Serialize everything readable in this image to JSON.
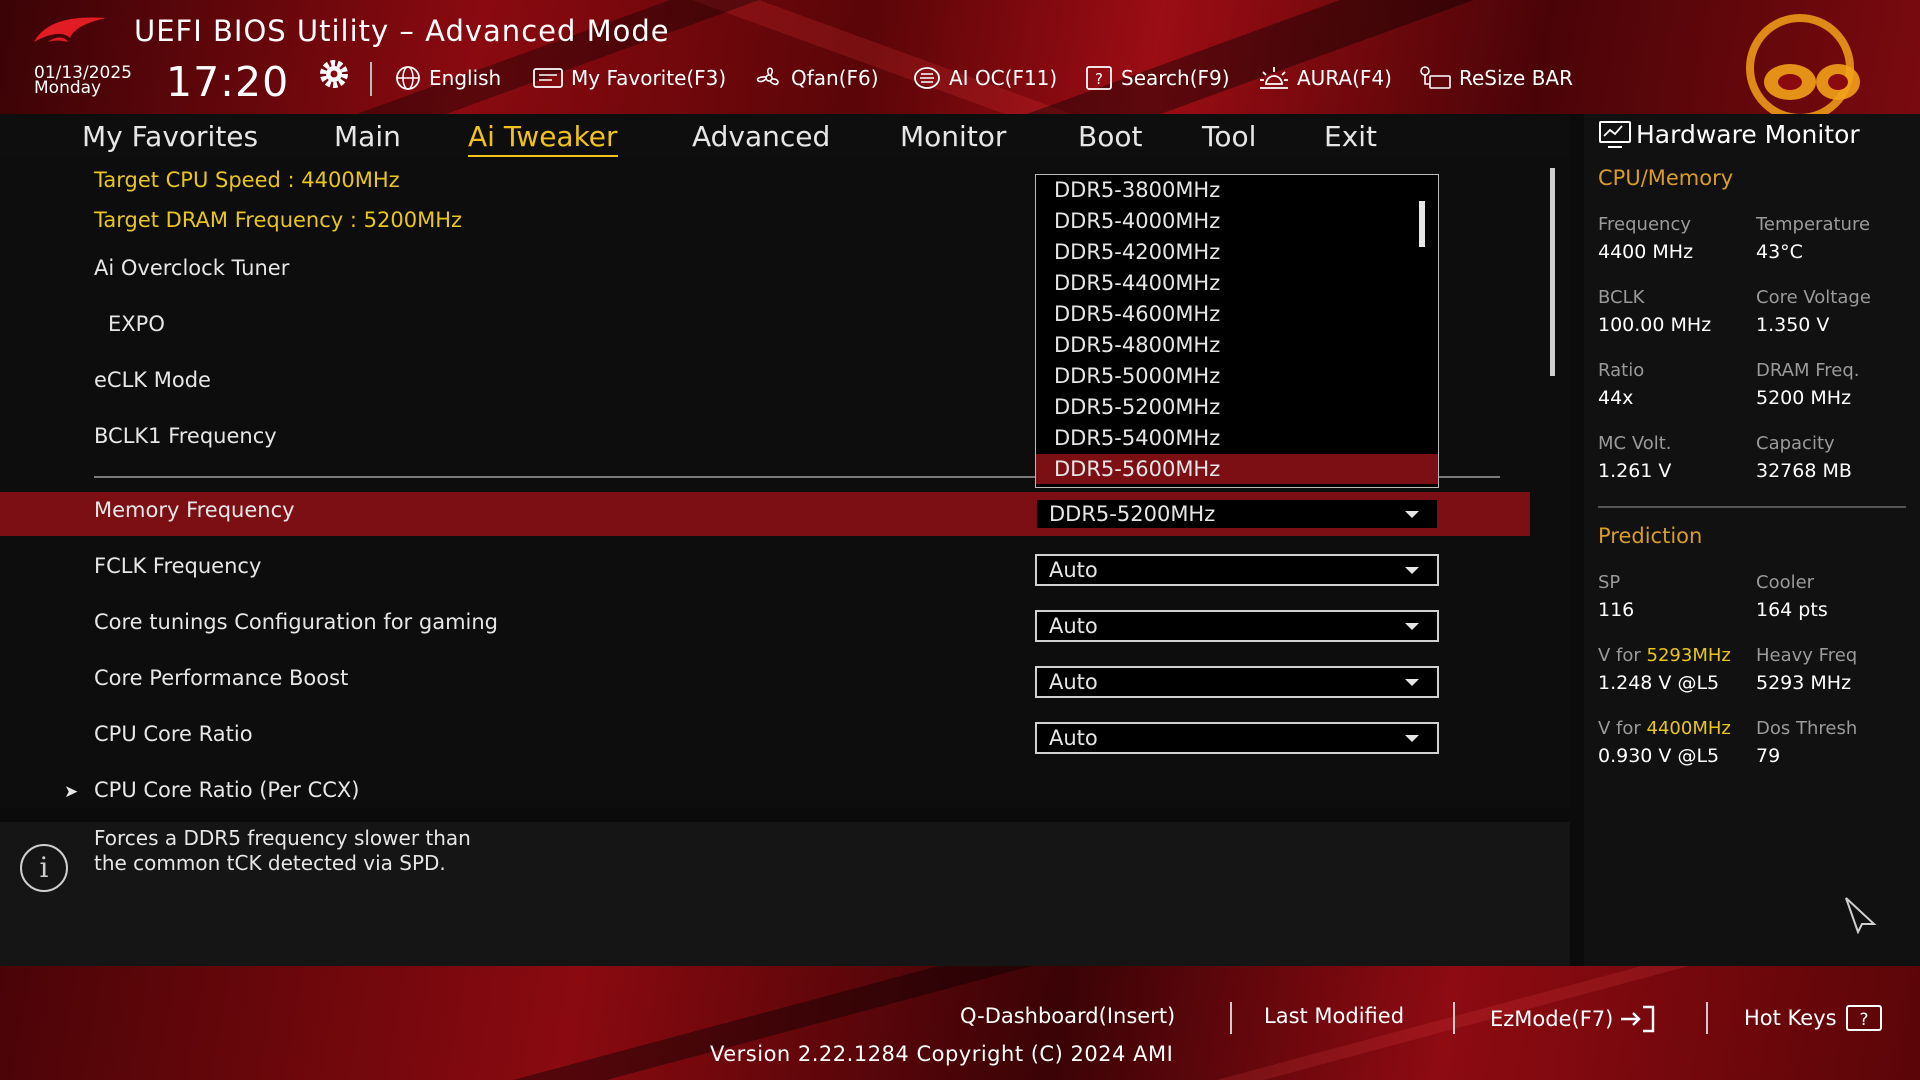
{
  "header": {
    "title": "UEFI BIOS Utility – Advanced Mode",
    "date": "01/13/2025",
    "day": "Monday",
    "time": "17:20",
    "toolbar": [
      {
        "label": "English",
        "icon": "globe-icon"
      },
      {
        "label": "My Favorite(F3)",
        "icon": "favorite-icon"
      },
      {
        "label": "Qfan(F6)",
        "icon": "fan-icon"
      },
      {
        "label": "AI OC(F11)",
        "icon": "ai-oc-icon"
      },
      {
        "label": "Search(F9)",
        "icon": "search-icon"
      },
      {
        "label": "AURA(F4)",
        "icon": "aura-icon"
      },
      {
        "label": "ReSize BAR",
        "icon": "resize-bar-icon"
      }
    ]
  },
  "nav": {
    "tabs": [
      "My Favorites",
      "Main",
      "Ai Tweaker",
      "Advanced",
      "Monitor",
      "Boot",
      "Tool",
      "Exit"
    ],
    "active": "Ai Tweaker"
  },
  "main": {
    "target_cpu": "Target CPU Speed : 4400MHz",
    "target_dram": "Target DRAM Frequency : 5200MHz",
    "settings": [
      {
        "label": "Ai Overclock Tuner"
      },
      {
        "label": "EXPO"
      },
      {
        "label": "eCLK Mode"
      },
      {
        "label": "BCLK1 Frequency"
      },
      {
        "label": "Memory Frequency",
        "value": "DDR5-5200MHz"
      },
      {
        "label": "FCLK Frequency",
        "value": "Auto"
      },
      {
        "label": "Core tunings Configuration for gaming",
        "value": "Auto"
      },
      {
        "label": "Core Performance Boost",
        "value": "Auto"
      },
      {
        "label": "CPU Core Ratio",
        "value": "Auto"
      },
      {
        "label": "CPU Core Ratio (Per CCX)"
      }
    ],
    "dropdown_options": [
      "DDR5-3800MHz",
      "DDR5-4000MHz",
      "DDR5-4200MHz",
      "DDR5-4400MHz",
      "DDR5-4600MHz",
      "DDR5-4800MHz",
      "DDR5-5000MHz",
      "DDR5-5200MHz",
      "DDR5-5400MHz",
      "DDR5-5600MHz"
    ],
    "dropdown_highlighted": "DDR5-5600MHz"
  },
  "help": {
    "line1": "Forces a DDR5 frequency slower than",
    "line2": "the common tCK detected via SPD."
  },
  "hardware_monitor": {
    "title": "Hardware Monitor",
    "cpu_memory": {
      "section": "CPU/Memory",
      "items": [
        {
          "label": "Frequency",
          "value": "4400 MHz"
        },
        {
          "label": "Temperature",
          "value": "43°C"
        },
        {
          "label": "BCLK",
          "value": "100.00 MHz"
        },
        {
          "label": "Core Voltage",
          "value": "1.350 V"
        },
        {
          "label": "Ratio",
          "value": "44x"
        },
        {
          "label": "DRAM Freq.",
          "value": "5200 MHz"
        },
        {
          "label": "MC Volt.",
          "value": "1.261 V"
        },
        {
          "label": "Capacity",
          "value": "32768 MB"
        }
      ]
    },
    "prediction": {
      "section": "Prediction",
      "sp_label": "SP",
      "sp_value": "116",
      "cooler_label": "Cooler",
      "cooler_value": "164 pts",
      "vfor_label": "V for",
      "vfor1_freq": "5293MHz",
      "vfor1_value": "1.248 V @L5",
      "heavy_label": "Heavy Freq",
      "heavy_value": "5293 MHz",
      "vfor2_freq": "4400MHz",
      "vfor2_value": "0.930 V @L5",
      "dos_label": "Dos Thresh",
      "dos_value": "79"
    }
  },
  "footer": {
    "qdashboard": "Q-Dashboard(Insert)",
    "last_modified": "Last Modified",
    "ezmode": "EzMode(F7)",
    "hotkeys": "Hot Keys",
    "version": "Version 2.22.1284 Copyright (C) 2024 AMI"
  },
  "colors": {
    "accent_red": "#7c0f14",
    "accent_yellow": "#f2c21a",
    "section_orange": "#d89c2a"
  }
}
